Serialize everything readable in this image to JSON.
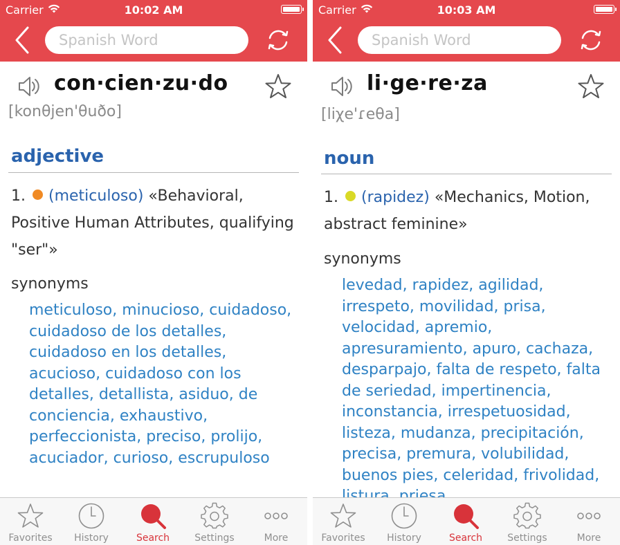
{
  "screens": [
    {
      "status": {
        "carrier": "Carrier",
        "time": "10:02 AM"
      },
      "search": {
        "placeholder": "Spanish Word"
      },
      "entry": {
        "headword": "con·cien·zu·do",
        "pronunciation": "[konθjen'θuðo]",
        "part_of_speech": "adjective",
        "definition": {
          "number": "1.",
          "dot_color": "#f08a24",
          "domain": "(meticuloso)",
          "text": " «Behavioral, Positive Human Attributes, qualifying \"ser\"»"
        },
        "synonyms_label": "synonyms",
        "synonyms": "meticuloso, minucioso, cuidadoso, cuidadoso de los detalles, cuidadoso en los detalles, acucioso, cuidadoso con los detalles, detallista, asiduo, de conciencia, exhaustivo, perfeccionista, preciso, prolijo, acuciador, curioso, escrupuloso"
      }
    },
    {
      "status": {
        "carrier": "Carrier",
        "time": "10:03 AM"
      },
      "search": {
        "placeholder": "Spanish Word"
      },
      "entry": {
        "headword": "li·ge·re·za",
        "pronunciation": "[liχe'ɾeθa]",
        "part_of_speech": "noun",
        "definition": {
          "number": "1.",
          "dot_color": "#d9d926",
          "domain": "(rapidez)",
          "text": " «Mechanics, Motion, abstract feminine»"
        },
        "synonyms_label": "synonyms",
        "synonyms": "levedad, rapidez, agilidad, irrespeto, movilidad, prisa, velocidad, apremio, apresuramiento, apuro, cachaza, desparpajo, falta de respeto, falta de seriedad, impertinencia, inconstancia, irrespetuosidad, listeza, mudanza, precipitación, precisa, premura, volubilidad, buenos pies, celeridad, frivolidad, listura, priesa"
      }
    }
  ],
  "tabs": [
    {
      "label": "Favorites",
      "icon": "star-icon"
    },
    {
      "label": "History",
      "icon": "clock-icon"
    },
    {
      "label": "Search",
      "icon": "magnifier-icon",
      "active": true
    },
    {
      "label": "Settings",
      "icon": "gear-icon"
    },
    {
      "label": "More",
      "icon": "more-dots-icon"
    }
  ],
  "colors": {
    "header": "#e5484d",
    "accent": "#d8333a",
    "pos": "#2a63ad",
    "link": "#2f82c4"
  }
}
